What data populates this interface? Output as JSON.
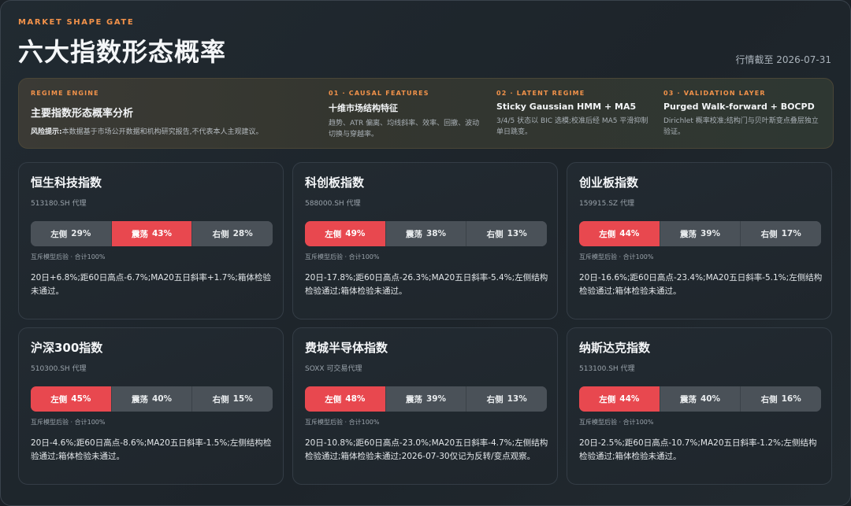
{
  "header": {
    "kicker": "MARKET SHAPE GATE",
    "title": "六大指数形态概率",
    "date": "行情截至 2026-07-31"
  },
  "engine": {
    "kicker": "REGIME ENGINE",
    "title": "主要指数形态概率分析",
    "risk_label": "风险提示:",
    "risk_text": "本数据基于市场公开数据和机构研究报告,不代表本人主观建议。",
    "steps": [
      {
        "kicker": "01 · CAUSAL FEATURES",
        "title": "十维市场结构特征",
        "text": "趋势、ATR 偏离、均线斜率、效率、回撤、波动切换与穿越率。"
      },
      {
        "kicker": "02 · LATENT REGIME",
        "title": "Sticky Gaussian HMM + MA5",
        "text": "3/4/5 状态以 BIC 选模;校准后经 MA5 平滑抑制单日跳变。"
      },
      {
        "kicker": "03 · VALIDATION LAYER",
        "title": "Purged Walk-forward + BOCPD",
        "text": "Dirichlet 概率校准;结构门与贝叶斯变点叠层独立验证。"
      }
    ]
  },
  "segment_labels": {
    "left": "左侧",
    "range": "震荡",
    "right": "右侧"
  },
  "note": "互斥模型后验 · 合计100%",
  "cards": [
    {
      "name": "恒生科技指数",
      "code": "513180.SH 代理",
      "left": "29%",
      "range": "43%",
      "right": "28%",
      "hot": "range",
      "probs": [
        29,
        43,
        28
      ],
      "desc": "20日+6.8%;距60日高点-6.7%;MA20五日斜率+1.7%;箱体检验未通过。"
    },
    {
      "name": "科创板指数",
      "code": "588000.SH 代理",
      "left": "49%",
      "range": "38%",
      "right": "13%",
      "hot": "left",
      "probs": [
        49,
        38,
        13
      ],
      "desc": "20日-17.8%;距60日高点-26.3%;MA20五日斜率-5.4%;左侧结构检验通过;箱体检验未通过。"
    },
    {
      "name": "创业板指数",
      "code": "159915.SZ 代理",
      "left": "44%",
      "range": "39%",
      "right": "17%",
      "hot": "left",
      "probs": [
        44,
        39,
        17
      ],
      "desc": "20日-16.6%;距60日高点-23.4%;MA20五日斜率-5.1%;左侧结构检验通过;箱体检验未通过。"
    },
    {
      "name": "沪深300指数",
      "code": "510300.SH 代理",
      "left": "45%",
      "range": "40%",
      "right": "15%",
      "hot": "left",
      "probs": [
        45,
        40,
        15
      ],
      "desc": "20日-4.6%;距60日高点-8.6%;MA20五日斜率-1.5%;左侧结构检验通过;箱体检验未通过。"
    },
    {
      "name": "费城半导体指数",
      "code": "SOXX 可交易代理",
      "left": "48%",
      "range": "39%",
      "right": "13%",
      "hot": "left",
      "probs": [
        48,
        39,
        13
      ],
      "desc": "20日-10.8%;距60日高点-23.0%;MA20五日斜率-4.7%;左侧结构检验通过;箱体检验未通过;2026-07-30仅记为反转/变点观察。"
    },
    {
      "name": "纳斯达克指数",
      "code": "513100.SH 代理",
      "left": "44%",
      "range": "40%",
      "right": "16%",
      "hot": "left",
      "probs": [
        44,
        40,
        16
      ],
      "desc": "20日-2.5%;距60日高点-10.7%;MA20五日斜率-1.2%;左侧结构检验通过;箱体检验未通过。"
    }
  ],
  "colors": {
    "accent": "#f2924a",
    "hot": "#e8484f",
    "segment": "#4a5158"
  }
}
